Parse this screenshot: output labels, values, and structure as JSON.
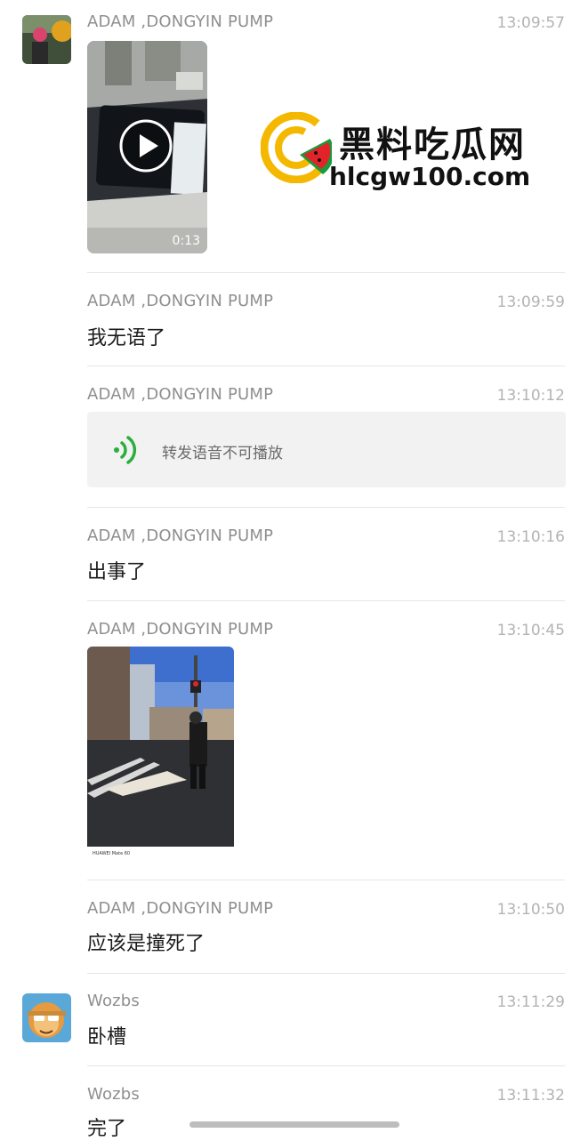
{
  "watermark": {
    "title": "黑料吃瓜网",
    "url": "hlcgw100.com"
  },
  "messages": [
    {
      "sender": "ADAM ,DONGYIN PUMP",
      "time": "13:09:57",
      "type": "video",
      "duration": "0:13"
    },
    {
      "sender": "ADAM ,DONGYIN PUMP",
      "time": "13:09:59",
      "type": "text",
      "text": "我无语了"
    },
    {
      "sender": "ADAM ,DONGYIN PUMP",
      "time": "13:10:12",
      "type": "voice",
      "text": "转发语音不可播放"
    },
    {
      "sender": "ADAM ,DONGYIN PUMP",
      "time": "13:10:16",
      "type": "text",
      "text": "出事了"
    },
    {
      "sender": "ADAM ,DONGYIN PUMP",
      "time": "13:10:45",
      "type": "image",
      "caption_brand": "HUAWEI Mate 60"
    },
    {
      "sender": "ADAM ,DONGYIN PUMP",
      "time": "13:10:50",
      "type": "text",
      "text": "应该是撞死了"
    },
    {
      "sender": "Wozbs",
      "time": "13:11:29",
      "type": "text",
      "text": "卧槽"
    },
    {
      "sender": "Wozbs",
      "time": "13:11:32",
      "type": "text",
      "text": "完了"
    }
  ],
  "colors": {
    "voice_icon": "#2aae3c",
    "watermark_ring": "#f5b800",
    "watermark_melon_red": "#e2242a",
    "watermark_melon_green": "#1a9a3a"
  }
}
